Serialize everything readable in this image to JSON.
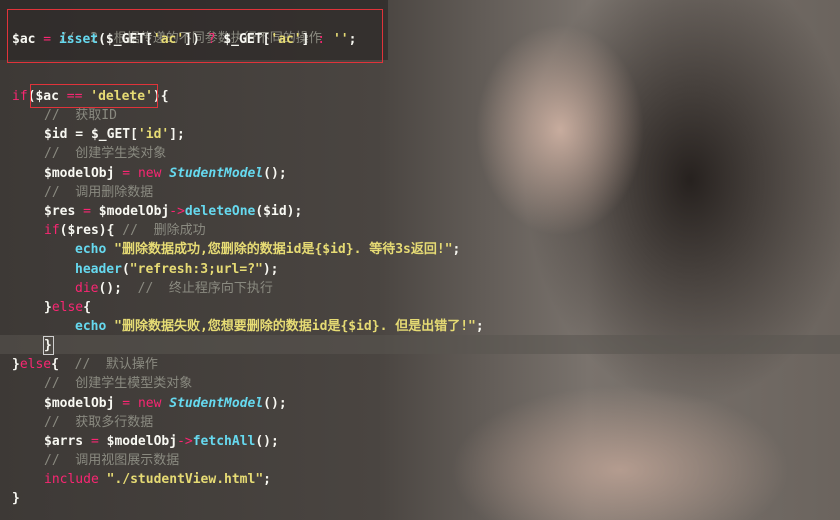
{
  "code": {
    "l1": {
      "comment": "//  2. 根据传递的不同参数执行不同的操作"
    },
    "l2": {
      "var": "$ac",
      "op": " = ",
      "fn": "isset",
      "p1": "($_GET[",
      "key": "'ac'",
      "p2": "]) ",
      "q": "?",
      "p3": " $_GET[",
      "key2": "'ac'",
      "p4": "] ",
      "colon": ":",
      "sp": " ",
      "empty": "''",
      "end": ";"
    },
    "l4": {
      "kw": "if",
      "p1": "(",
      "var": "$ac",
      "op": " == ",
      "str": "'delete'",
      "p2": "){"
    },
    "l5": {
      "comment": "//  获取ID"
    },
    "l6": {
      "code": "$id = $_GET[",
      "str": "'id'",
      "end": "];"
    },
    "l7": {
      "comment": "//  创建学生类对象"
    },
    "l8": {
      "var": "$modelObj",
      "op": " = ",
      "kw": "new",
      "sp": " ",
      "cls": "StudentModel",
      "end": "();"
    },
    "l9": {
      "comment": "//  调用删除数据"
    },
    "l10": {
      "var": "$res",
      "op": " = ",
      "obj": "$modelObj",
      "arrow": "->",
      "fn": "deleteOne",
      "end": "($id);"
    },
    "l11": {
      "kw": "if",
      "p1": "($res){ ",
      "comment": "//  删除成功"
    },
    "l12": {
      "kw": "echo",
      "sp": " ",
      "str": "\"删除数据成功,您删除的数据id是{$id}. 等待3s返回!\"",
      "end": ";"
    },
    "l13": {
      "fn": "header",
      "p1": "(",
      "str": "\"refresh:3;url=?\"",
      "end": ");"
    },
    "l14": {
      "kw": "die",
      "p1": "();  ",
      "comment": "//  终止程序向下执行"
    },
    "l15": {
      "p1": "}",
      "kw": "else",
      "p2": "{"
    },
    "l16": {
      "kw": "echo",
      "sp": " ",
      "str": "\"删除数据失败,您想要删除的数据id是{$id}. 但是出错了!\"",
      "end": ";"
    },
    "l17": {
      "p1": "}"
    },
    "l18": {
      "p1": "}",
      "kw": "else",
      "p2": "{  ",
      "comment": "//  默认操作"
    },
    "l19": {
      "comment": "//  创建学生模型类对象"
    },
    "l20": {
      "var": "$modelObj",
      "op": " = ",
      "kw": "new",
      "sp": " ",
      "cls": "StudentModel",
      "end": "();"
    },
    "l21": {
      "comment": "//  获取多行数据"
    },
    "l22": {
      "var": "$arrs",
      "op": " = ",
      "obj": "$modelObj",
      "arrow": "->",
      "fn": "fetchAll",
      "end": "();"
    },
    "l23": {
      "comment": "//  调用视图展示数据"
    },
    "l24": {
      "kw": "include",
      "sp": " ",
      "str": "\"./studentView.html\"",
      "end": ";"
    },
    "l25": {
      "p1": "}"
    }
  },
  "colors": {
    "comment": "#8a8a80",
    "keyword": "#f92672",
    "function": "#66d9ef",
    "string": "#e6db74",
    "highlight_box": "#e0333a"
  }
}
